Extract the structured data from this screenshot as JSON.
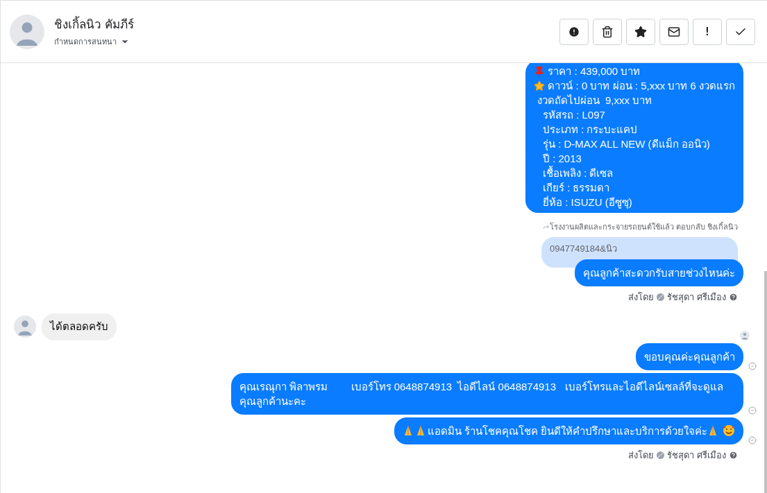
{
  "header": {
    "name": "ชิงเกิ้ลนิว คัมภีร์",
    "subtitle": "กำหนดการสนทนา",
    "toolbar": [
      {
        "kind": "alert"
      },
      {
        "kind": "trash"
      },
      {
        "kind": "star"
      },
      {
        "kind": "mail"
      },
      {
        "kind": "text",
        "label": "!"
      },
      {
        "kind": "check"
      }
    ]
  },
  "messages": [
    {
      "kind": "outgoing",
      "check": false,
      "lines": [
        [
          {
            "kind": "pin"
          },
          {
            "kind": "text",
            "text": "ราคา : 439,000 บาท"
          }
        ],
        [
          {
            "kind": "star"
          },
          {
            "kind": "text",
            "text": "ดาวน์ : 0 บาท ผ่อน : 5,xxx บาท 6 งวดแรก"
          }
        ],
        [
          {
            "kind": "text",
            "text": " งวดถัดไปผ่อน  9,xxx บาท"
          }
        ],
        [
          {
            "kind": "text",
            "text": "   รหัสรถ : L097"
          }
        ],
        [
          {
            "kind": "text",
            "text": "   ประเภท : กระบะแคป"
          }
        ],
        [
          {
            "kind": "text",
            "text": "   รุ่น : D-MAX ALL NEW (ดีแม็ก ออนิว)"
          }
        ],
        [
          {
            "kind": "text",
            "text": "   ปี : 2013"
          }
        ],
        [
          {
            "kind": "text",
            "text": "   เชื้อเพลิง : ดีเซล"
          }
        ],
        [
          {
            "kind": "text",
            "text": "   เกียร์ : ธรรมดา"
          }
        ],
        [
          {
            "kind": "text",
            "text": "   ยี่ห้อ : ISUZU (อีซูซุ)"
          }
        ]
      ]
    },
    {
      "kind": "reply_note",
      "text": "โรงงานผลิตและกระจายรถยนต์ใช้แล้ว ตอบกลับ ชิงเกิ้ลนิว"
    },
    {
      "kind": "quoted",
      "text": "0947749184&นิว"
    },
    {
      "kind": "outgoing",
      "check": false,
      "lines": [
        [
          {
            "kind": "text",
            "text": "คุณลูกค้าสะดวกรับสายช่วงไหนค่ะ"
          }
        ]
      ]
    },
    {
      "kind": "sent_by",
      "prefix": "ส่งโดย",
      "name": "รัชสุดา ศรีเมือง"
    },
    {
      "kind": "incoming",
      "text": "ได้ตลอดครับ"
    },
    {
      "kind": "seen_avatar"
    },
    {
      "kind": "outgoing",
      "check": true,
      "lines": [
        [
          {
            "kind": "text",
            "text": "ขอบคุณค่ะคุณลูกค้า"
          }
        ]
      ]
    },
    {
      "kind": "outgoing",
      "check": true,
      "lines": [
        [
          {
            "kind": "text",
            "text": "คุณเรณุกา พิลาพรม        เบอร์โทร 0648874913  ไอดีไลน์ 0648874913   เบอร์โทรและไอดีไลน์เซลล์ที่จะดูแลคุณลูกค้านะคะ"
          }
        ]
      ]
    },
    {
      "kind": "outgoing",
      "check": true,
      "lines": [
        [
          {
            "kind": "pray"
          },
          {
            "kind": "pray"
          },
          {
            "kind": "text",
            "text": "แอดมิน ร้านโชคคุณโชค ยินดีให้คำปรึกษาและบริการด้วยใจค่ะ"
          },
          {
            "kind": "pray"
          },
          {
            "kind": "smile"
          }
        ]
      ]
    },
    {
      "kind": "sent_by",
      "prefix": "ส่งโดย",
      "name": "รัชสุดา ศรีเมือง"
    }
  ]
}
